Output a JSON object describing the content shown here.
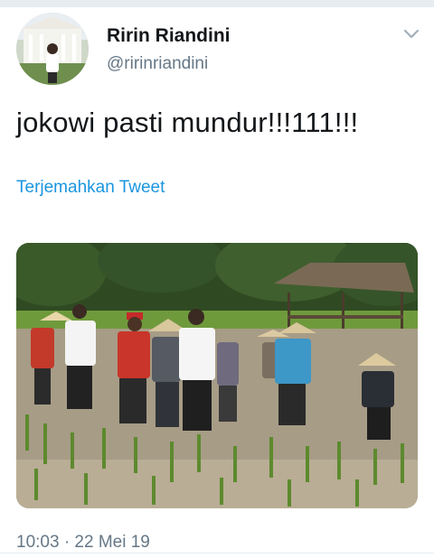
{
  "tweet": {
    "display_name": "Ririn Riandini",
    "handle": "@ririnriandini",
    "text": "jokowi pasti mundur!!!111!!!",
    "translate_label": "Terjemahkan Tweet",
    "timestamp": "10:03 · 22 Mei 19"
  },
  "icons": {
    "menu": "chevron-down-icon"
  },
  "colors": {
    "link": "#1b95e0",
    "secondary_text": "#657786",
    "primary_text": "#14171a",
    "divider": "#e6ecf0"
  }
}
